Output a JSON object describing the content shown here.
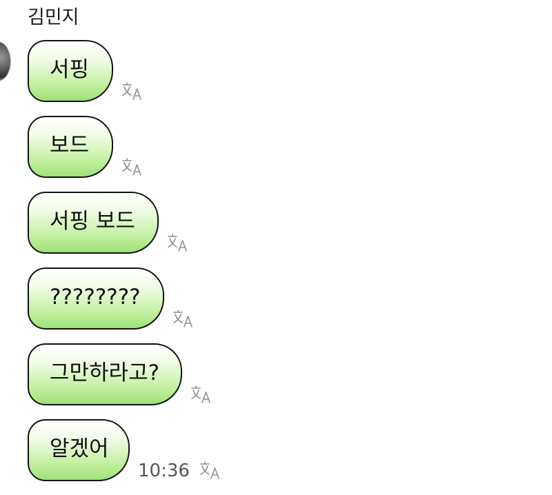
{
  "chat": {
    "sender_name": "김민지",
    "messages": [
      {
        "text": "서핑"
      },
      {
        "text": "보드"
      },
      {
        "text": "서핑 보드"
      },
      {
        "text": "????????"
      },
      {
        "text": "그만하라고?"
      },
      {
        "text": "알겠어",
        "time": "10:36"
      }
    ],
    "translate_icon": "translate-icon",
    "bubble_colors": {
      "top": "#ffffff",
      "bottom": "#9fe07a",
      "border": "#111111"
    }
  }
}
